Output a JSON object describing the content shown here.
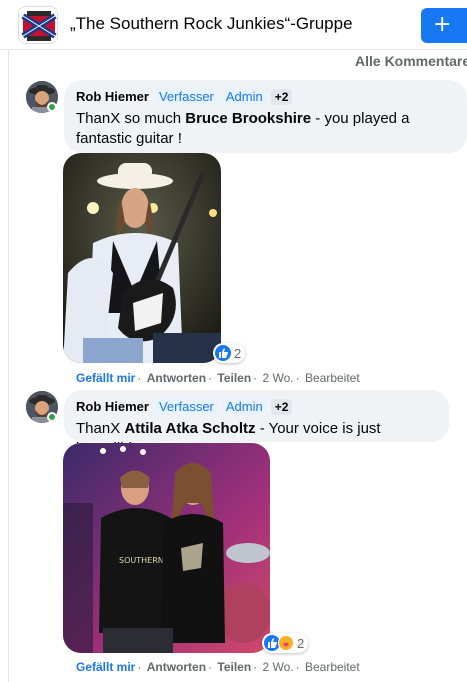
{
  "header": {
    "group_title": "„The Southern Rock Junkies“-Gruppe",
    "join_icon": "+"
  },
  "sort": {
    "label": "Alle Kommentare"
  },
  "comments": [
    {
      "author": "Rob Hiemer",
      "badges": [
        "Verfasser",
        "Admin"
      ],
      "more_badges": "+2",
      "text_prefix": "ThanX so much",
      "mention": "Bruce Brookshire",
      "text_suffix": "- you played a fantastic guitar !",
      "reaction_count": "2",
      "actions": {
        "like": "Gefällt mir",
        "reply": "Antworten",
        "share": "Teilen",
        "time": "2 Wo.",
        "edited": "Bearbeitet"
      }
    },
    {
      "author": "Rob Hiemer",
      "badges": [
        "Verfasser",
        "Admin"
      ],
      "more_badges": "+2",
      "text_prefix": "ThanX",
      "mention": "Attila Atka Scholtz",
      "text_suffix": "- Your voice is just incredible",
      "reaction_count": "2",
      "actions": {
        "like": "Gefällt mir",
        "reply": "Antworten",
        "share": "Teilen",
        "time": "2 Wo.",
        "edited": "Bearbeitet"
      }
    }
  ],
  "colors": {
    "accent": "#1877f2",
    "online": "#31a24c",
    "bubble": "#f0f2f5"
  }
}
